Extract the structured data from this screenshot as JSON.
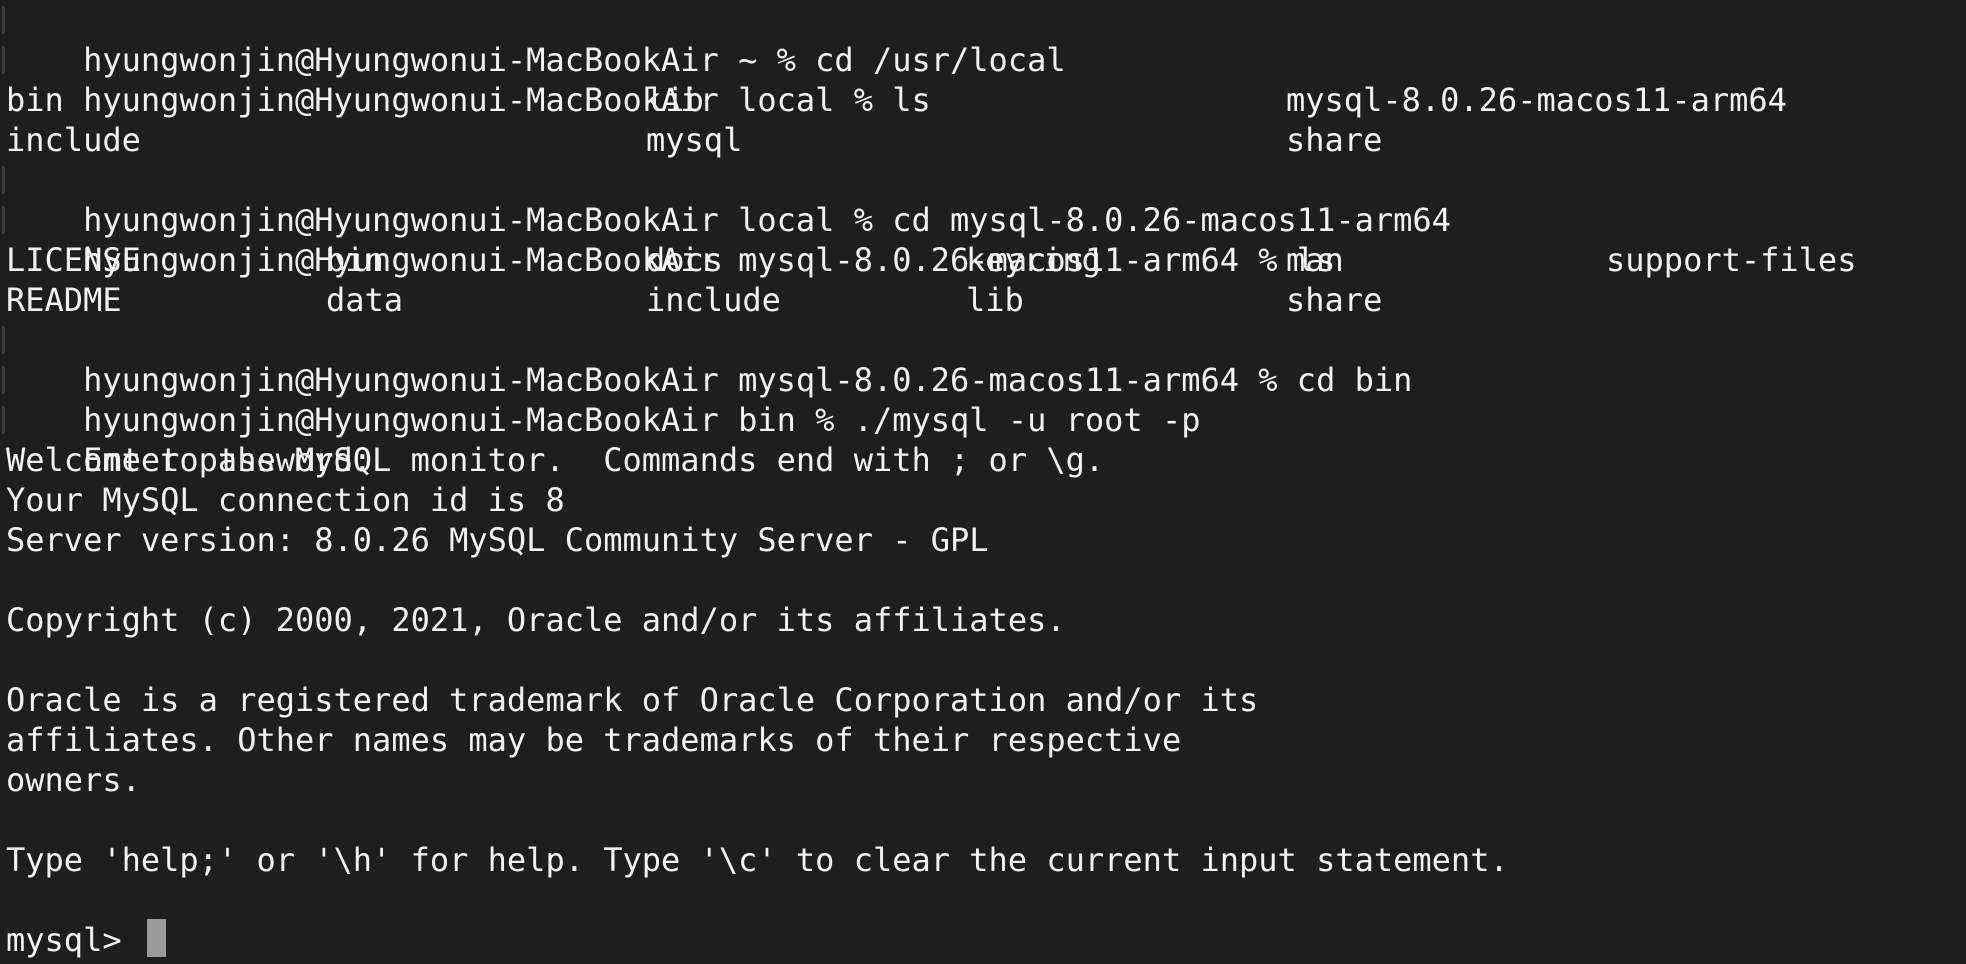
{
  "terminal": {
    "line1": "hyungwonjin@Hyungwonui-MacBookAir ~ % cd /usr/local",
    "line2": "hyungwonjin@Hyungwonui-MacBookAir local % ls",
    "ls1": {
      "row1": [
        "bin",
        "lib",
        "mysql-8.0.26-macos11-arm64"
      ],
      "row2": [
        "include",
        "mysql",
        "share"
      ]
    },
    "line3": "hyungwonjin@Hyungwonui-MacBookAir local % cd mysql-8.0.26-macos11-arm64",
    "line4": "hyungwonjin@Hyungwonui-MacBookAir mysql-8.0.26-macos11-arm64 % ls",
    "ls2": {
      "row1": [
        "LICENSE",
        "bin",
        "docs",
        "keyring",
        "man",
        "support-files"
      ],
      "row2": [
        "README",
        "data",
        "include",
        "lib",
        "share",
        ""
      ]
    },
    "line5": "hyungwonjin@Hyungwonui-MacBookAir mysql-8.0.26-macos11-arm64 % cd bin",
    "line6": "hyungwonjin@Hyungwonui-MacBookAir bin % ./mysql -u root -p",
    "line7": "Enter password:",
    "line8": "Welcome to the MySQL monitor.  Commands end with ; or \\g.",
    "line9": "Your MySQL connection id is 8",
    "line10": "Server version: 8.0.26 MySQL Community Server - GPL",
    "line11": "Copyright (c) 2000, 2021, Oracle and/or its affiliates.",
    "line12": "Oracle is a registered trademark of Oracle Corporation and/or its",
    "line13": "affiliates. Other names may be trademarks of their respective",
    "line14": "owners.",
    "line15": "Type 'help;' or '\\h' for help. Type '\\c' to clear the current input statement.",
    "prompt": "mysql> "
  }
}
